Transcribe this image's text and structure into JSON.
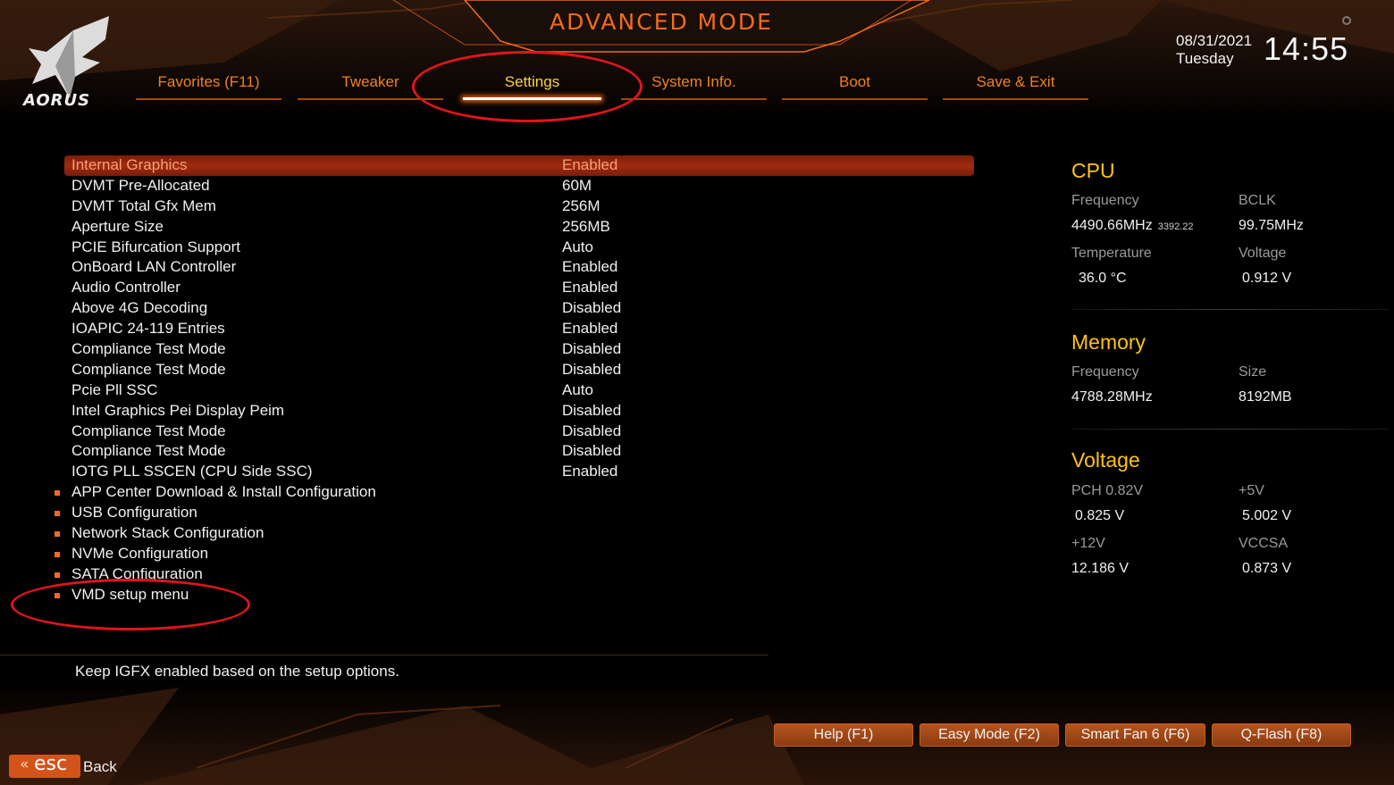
{
  "header": {
    "brand": "AORUS",
    "mode_title": "ADVANCED MODE",
    "date": "08/31/2021",
    "weekday": "Tuesday",
    "time": "14:55"
  },
  "tabs": [
    {
      "label": "Favorites (F11)",
      "active": false
    },
    {
      "label": "Tweaker",
      "active": false
    },
    {
      "label": "Settings",
      "active": true
    },
    {
      "label": "System Info.",
      "active": false
    },
    {
      "label": "Boot",
      "active": false
    },
    {
      "label": "Save & Exit",
      "active": false
    }
  ],
  "settings": [
    {
      "label": "Internal Graphics",
      "value": "Enabled",
      "selected": true
    },
    {
      "label": "DVMT Pre-Allocated",
      "value": "60M"
    },
    {
      "label": "DVMT Total Gfx Mem",
      "value": "256M"
    },
    {
      "label": "Aperture Size",
      "value": "256MB"
    },
    {
      "label": "PCIE Bifurcation Support",
      "value": "Auto"
    },
    {
      "label": "OnBoard LAN Controller",
      "value": "Enabled"
    },
    {
      "label": "Audio Controller",
      "value": "Enabled"
    },
    {
      "label": "Above 4G Decoding",
      "value": "Disabled"
    },
    {
      "label": "IOAPIC 24-119 Entries",
      "value": "Enabled"
    },
    {
      "label": "Compliance Test Mode",
      "value": "Disabled"
    },
    {
      "label": "Compliance Test Mode",
      "value": "Disabled"
    },
    {
      "label": "Pcie Pll SSC",
      "value": "Auto"
    },
    {
      "label": "Intel Graphics Pei Display Peim",
      "value": "Disabled"
    },
    {
      "label": "Compliance Test Mode",
      "value": "Disabled"
    },
    {
      "label": "Compliance Test Mode",
      "value": "Disabled"
    },
    {
      "label": "IOTG PLL SSCEN (CPU Side SSC)",
      "value": "Enabled"
    }
  ],
  "submenus": [
    {
      "label": "APP Center Download & Install Configuration"
    },
    {
      "label": "USB Configuration"
    },
    {
      "label": "Network Stack Configuration"
    },
    {
      "label": "NVMe Configuration"
    },
    {
      "label": "SATA Configuration"
    },
    {
      "label": "VMD setup menu"
    }
  ],
  "help_text": "Keep IGFX enabled based on the setup options.",
  "hardware": {
    "cpu": {
      "title": "CPU",
      "frequency_label": "Frequency",
      "frequency": "4490.66MHz",
      "frequency_sub": "3392.22",
      "bclk_label": "BCLK",
      "bclk": "99.75MHz",
      "temperature_label": "Temperature",
      "temperature": "36.0 °C",
      "voltage_label": "Voltage",
      "voltage": "0.912 V"
    },
    "memory": {
      "title": "Memory",
      "frequency_label": "Frequency",
      "frequency": "4788.28MHz",
      "size_label": "Size",
      "size": "8192MB"
    },
    "voltage": {
      "title": "Voltage",
      "pch_label": "PCH 0.82V",
      "pch": "0.825 V",
      "v5_label": "+5V",
      "v5": "5.002 V",
      "v12_label": "+12V",
      "v12": "12.186 V",
      "vccsa_label": "VCCSA",
      "vccsa": "0.873 V"
    }
  },
  "footer": {
    "buttons": [
      {
        "label": "Help (F1)"
      },
      {
        "label": "Easy Mode (F2)"
      },
      {
        "label": "Smart Fan 6 (F6)"
      },
      {
        "label": "Q-Flash (F8)"
      }
    ],
    "esc_key": "esc",
    "back_label": "Back"
  },
  "colors": {
    "accent_orange": "#f26b1d",
    "active_tab": "#ffd23a",
    "section_title": "#ffc21a",
    "annotation_red": "#e0141e"
  }
}
